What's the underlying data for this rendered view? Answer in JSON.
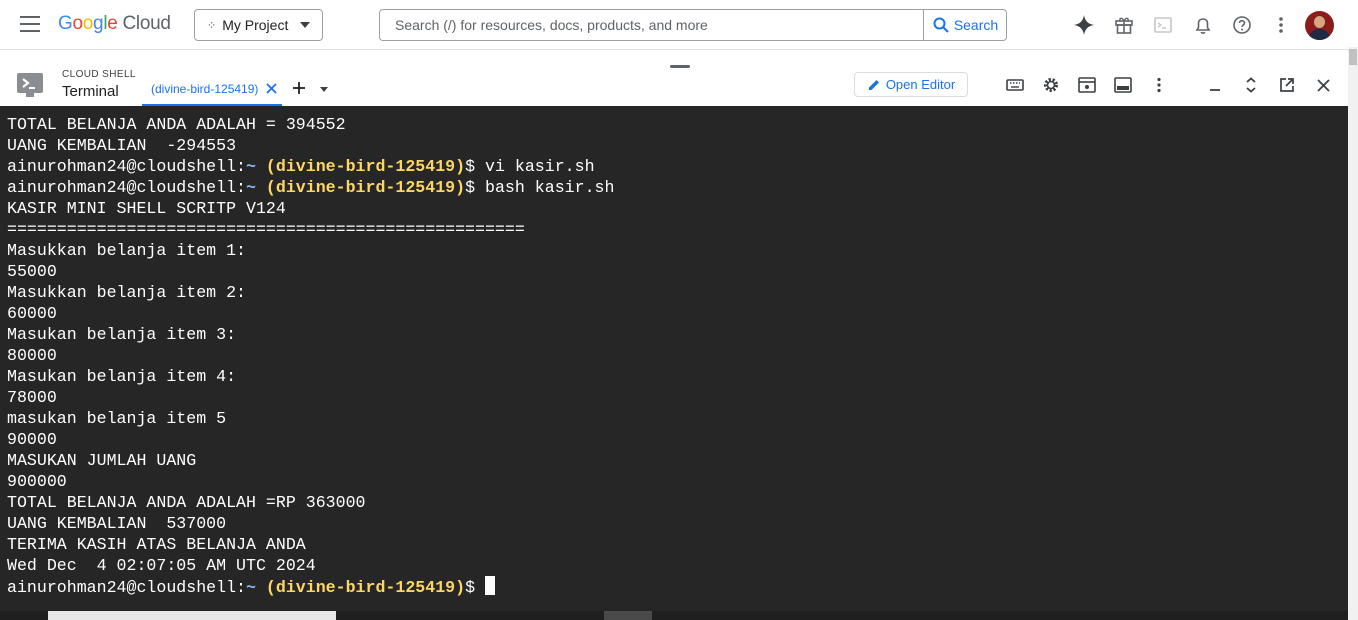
{
  "header": {
    "logo_google": "Google",
    "logo_cloud": "Cloud",
    "project_name": "My Project",
    "search_placeholder": "Search (/) for resources, docs, products, and more",
    "search_button": "Search"
  },
  "shell": {
    "small_title": "CLOUD SHELL",
    "title": "Terminal",
    "tab_label": "(divine-bird-125419)",
    "open_editor": "Open Editor"
  },
  "terminal": {
    "lines": [
      {
        "text": "TOTAL BELANJA ANDA ADALAH = 394552"
      },
      {
        "text": "UANG KEMBALIAN  -294553"
      },
      {
        "user": "ainurohman24@cloudshell:",
        "tilde": "~",
        "project": " (divine-bird-125419)",
        "cmd": "$ vi kasir.sh"
      },
      {
        "user": "ainurohman24@cloudshell:",
        "tilde": "~",
        "project": " (divine-bird-125419)",
        "cmd": "$ bash kasir.sh"
      },
      {
        "text": "KASIR MINI SHELL SCRITP V124"
      },
      {
        "text": "===================================================="
      },
      {
        "text": "Masukkan belanja item 1:"
      },
      {
        "text": "55000"
      },
      {
        "text": "Masukkan belanja item 2:"
      },
      {
        "text": "60000"
      },
      {
        "text": "Masukan belanja item 3:"
      },
      {
        "text": "80000"
      },
      {
        "text": "Masukan belanja item 4:"
      },
      {
        "text": "78000"
      },
      {
        "text": "masukan belanja item 5"
      },
      {
        "text": "90000"
      },
      {
        "text": "MASUKAN JUMLAH UANG"
      },
      {
        "text": "900000"
      },
      {
        "text": "TOTAL BELANJA ANDA ADALAH =RP 363000"
      },
      {
        "text": "UANG KEMBALIAN  537000"
      },
      {
        "text": "TERIMA KASIH ATAS BELANJA ANDA"
      },
      {
        "text": "Wed Dec  4 02:07:05 AM UTC 2024"
      },
      {
        "user": "ainurohman24@cloudshell:",
        "tilde": "~",
        "project": " (divine-bird-125419)",
        "cmd": "$ ",
        "cursor": true
      }
    ]
  },
  "colors": {
    "terminal_bg": "#262626",
    "prompt_project": "#fdd663",
    "prompt_tilde": "#8ab4f8",
    "accent": "#1a73e8"
  }
}
